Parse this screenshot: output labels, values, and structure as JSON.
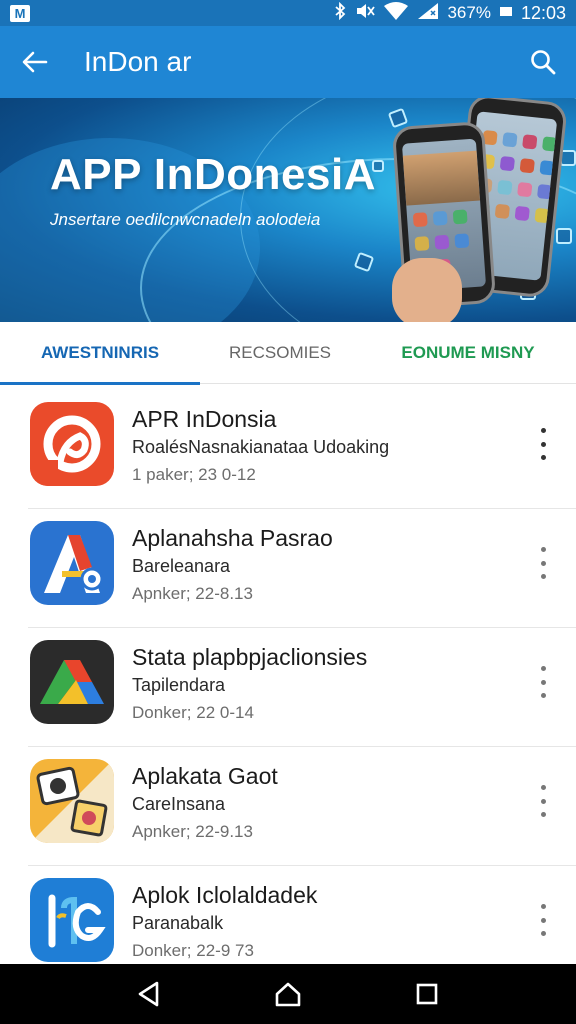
{
  "status_bar": {
    "logo": "M",
    "battery_text": "367%",
    "time": "12:03",
    "icons": [
      "bluetooth-icon",
      "mute-icon",
      "wifi-icon",
      "signal-icon",
      "battery-icon"
    ]
  },
  "app_bar": {
    "title": "InDon ar",
    "color": "#1f86d4"
  },
  "banner": {
    "title": "APP InDonesiA",
    "subtitle": "Jnsertare oedilcnwcnadeln aolodeia"
  },
  "tabs": [
    {
      "label": "AWESTNINRIS",
      "active": true
    },
    {
      "label": "RECSOMIES",
      "active": false
    },
    {
      "label": "EONUME MISNY",
      "active": false
    }
  ],
  "apps": [
    {
      "title": "APR InDonsia",
      "subtitle": "RoalésNasnakianataa Udoaking",
      "meta": "1 paker; 23 0-12",
      "icon": "red-swirl-app-icon"
    },
    {
      "title": "Aplanahsha Pasrao",
      "subtitle": "Bareleanara",
      "meta": "Apnker; 22-8.13",
      "icon": "blue-a-app-icon"
    },
    {
      "title": "Stata plapbpjaclionsies",
      "subtitle": "Tapilendara",
      "meta": "Donker; 22 0-14",
      "icon": "multicolor-a-app-icon"
    },
    {
      "title": "Aplakata Gaot",
      "subtitle": "CareInsana",
      "meta": "Apnker; 22-9.13",
      "icon": "camera-sticker-app-icon"
    },
    {
      "title": "Aplok Iclolaldadek",
      "subtitle": "Paranabalk",
      "meta": "Donker; 22-9 73",
      "icon": "blue-g-app-icon"
    }
  ],
  "colors": {
    "accent": "#1a73c6",
    "tab_green": "#1f9a52"
  }
}
